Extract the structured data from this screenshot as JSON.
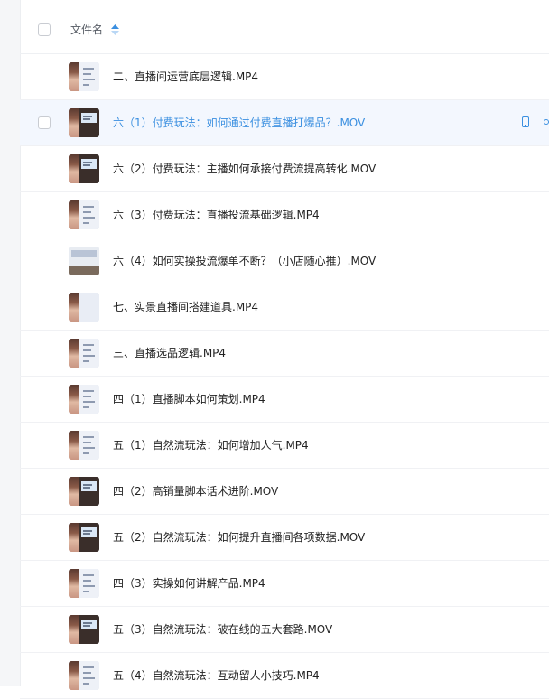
{
  "header": {
    "column_label": "文件名"
  },
  "files": [
    {
      "name": "二、直播间运营底层逻辑.MP4",
      "thumb": "doc",
      "active": false
    },
    {
      "name": "六（1）付费玩法：如何通过付费直播打爆品？.MOV",
      "thumb": "slide",
      "active": true
    },
    {
      "name": "六（2）付费玩法：主播如何承接付费流提高转化.MOV",
      "thumb": "slide",
      "active": false
    },
    {
      "name": "六（3）付费玩法：直播投流基础逻辑.MP4",
      "thumb": "doc",
      "active": false
    },
    {
      "name": "六（4）如何实操投流爆单不断？（小店随心推）.MOV",
      "thumb": "wide",
      "active": false
    },
    {
      "name": "七、实景直播间搭建道具.MP4",
      "thumb": "blank",
      "active": false
    },
    {
      "name": "三、直播选品逻辑.MP4",
      "thumb": "doc",
      "active": false
    },
    {
      "name": "四（1）直播脚本如何策划.MP4",
      "thumb": "doc",
      "active": false
    },
    {
      "name": "五（1）自然流玩法：如何增加人气.MP4",
      "thumb": "doc",
      "active": false
    },
    {
      "name": "四（2）高销量脚本话术进阶.MOV",
      "thumb": "slide",
      "active": false
    },
    {
      "name": "五（2）自然流玩法：如何提升直播间各项数据.MOV",
      "thumb": "slide",
      "active": false
    },
    {
      "name": "四（3）实操如何讲解产品.MP4",
      "thumb": "doc",
      "active": false
    },
    {
      "name": "五（3）自然流玩法：破在线的五大套路.MOV",
      "thumb": "slide",
      "active": false
    },
    {
      "name": "五（4）自然流玩法：互动留人小技巧.MP4",
      "thumb": "doc",
      "active": false
    }
  ],
  "colors": {
    "accent": "#3a8fe0",
    "active_row_bg": "#f3f7fe",
    "text": "#222222"
  },
  "icons": {
    "sort": "sort-icon",
    "phone": "phone-icon",
    "share": "share-icon"
  }
}
